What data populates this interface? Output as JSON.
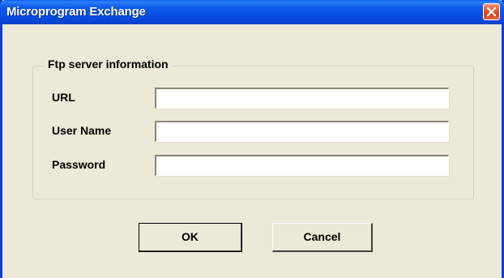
{
  "window": {
    "title": "Microprogram Exchange"
  },
  "titlebar_icons": {
    "close": "close-icon"
  },
  "groupbox": {
    "title": "Ftp server information"
  },
  "fields": {
    "url": {
      "label": "URL",
      "value": "",
      "placeholder": ""
    },
    "username": {
      "label": "User Name",
      "value": "",
      "placeholder": ""
    },
    "password": {
      "label": "Password",
      "value": "",
      "placeholder": ""
    }
  },
  "buttons": {
    "ok": "OK",
    "cancel": "Cancel"
  },
  "colors": {
    "titlebar": "#0a5ff5",
    "window_bg": "#ece9d8",
    "close_button": "#e4582a"
  }
}
